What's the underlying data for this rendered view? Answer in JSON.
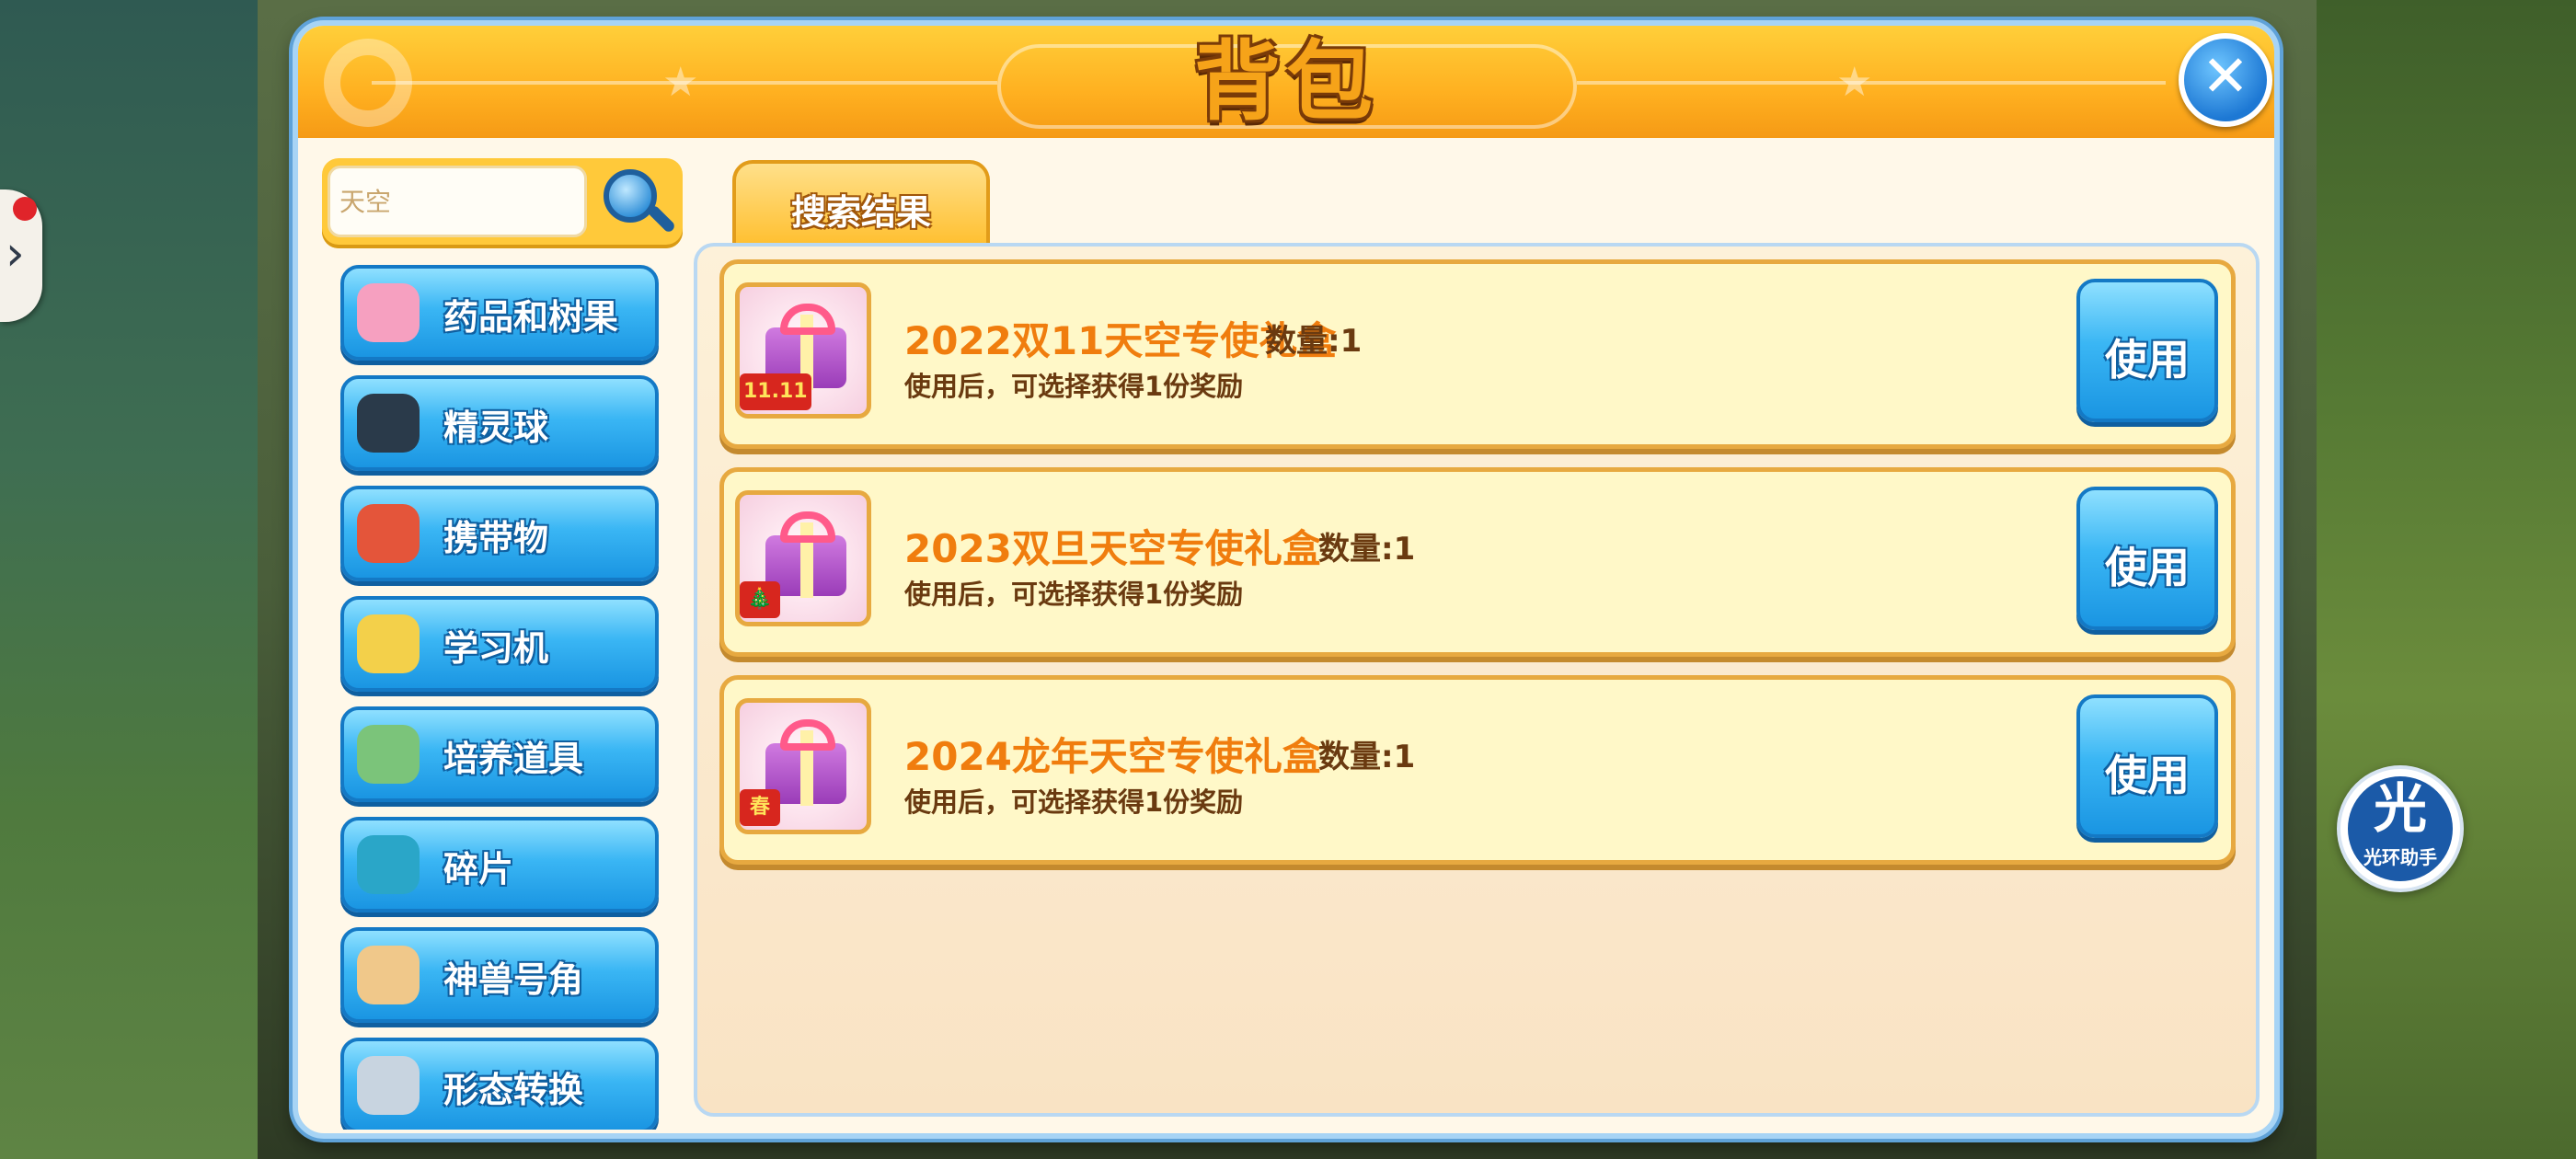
{
  "window": {
    "title": "背包",
    "close_icon": "close-icon"
  },
  "search": {
    "placeholder": "天空",
    "value": "",
    "icon": "search-icon"
  },
  "categories": [
    {
      "label": "药品和树果",
      "icon": "medicine-icon",
      "color": "#f6a0c0"
    },
    {
      "label": "精灵球",
      "icon": "pokeball-icon",
      "color": "#2a3a4a"
    },
    {
      "label": "携带物",
      "icon": "held-item-icon",
      "color": "#e4553a"
    },
    {
      "label": "学习机",
      "icon": "disc-icon",
      "color": "#f3d04a"
    },
    {
      "label": "培养道具",
      "icon": "training-item-icon",
      "color": "#7bc47a"
    },
    {
      "label": "碎片",
      "icon": "puzzle-piece-icon",
      "color": "#2aa6c8"
    },
    {
      "label": "神兽号角",
      "icon": "horn-icon",
      "color": "#f0c88a"
    },
    {
      "label": "形态转换",
      "icon": "transform-icon",
      "color": "#c8d4e0"
    }
  ],
  "tabs": [
    {
      "label": "搜索结果",
      "active": true
    }
  ],
  "items": [
    {
      "name": "2022双11天空专使礼盒",
      "quantity_label": "数量:1",
      "description": "使用后，可选择获得1份奖励",
      "badge": "11.11",
      "use_label": "使用"
    },
    {
      "name": "2023双旦天空专使礼盒",
      "quantity_label": "数量:1",
      "description": "使用后，可选择获得1份奖励",
      "badge": "🎄",
      "use_label": "使用"
    },
    {
      "name": "2024龙年天空专使礼盒",
      "quantity_label": "数量:1",
      "description": "使用后，可选择获得1份奖励",
      "badge": "春",
      "use_label": "使用"
    }
  ],
  "assistant": {
    "glyph": "光",
    "caption": "光环助手"
  },
  "side_tab": {
    "icon": "chevron-right-icon"
  }
}
